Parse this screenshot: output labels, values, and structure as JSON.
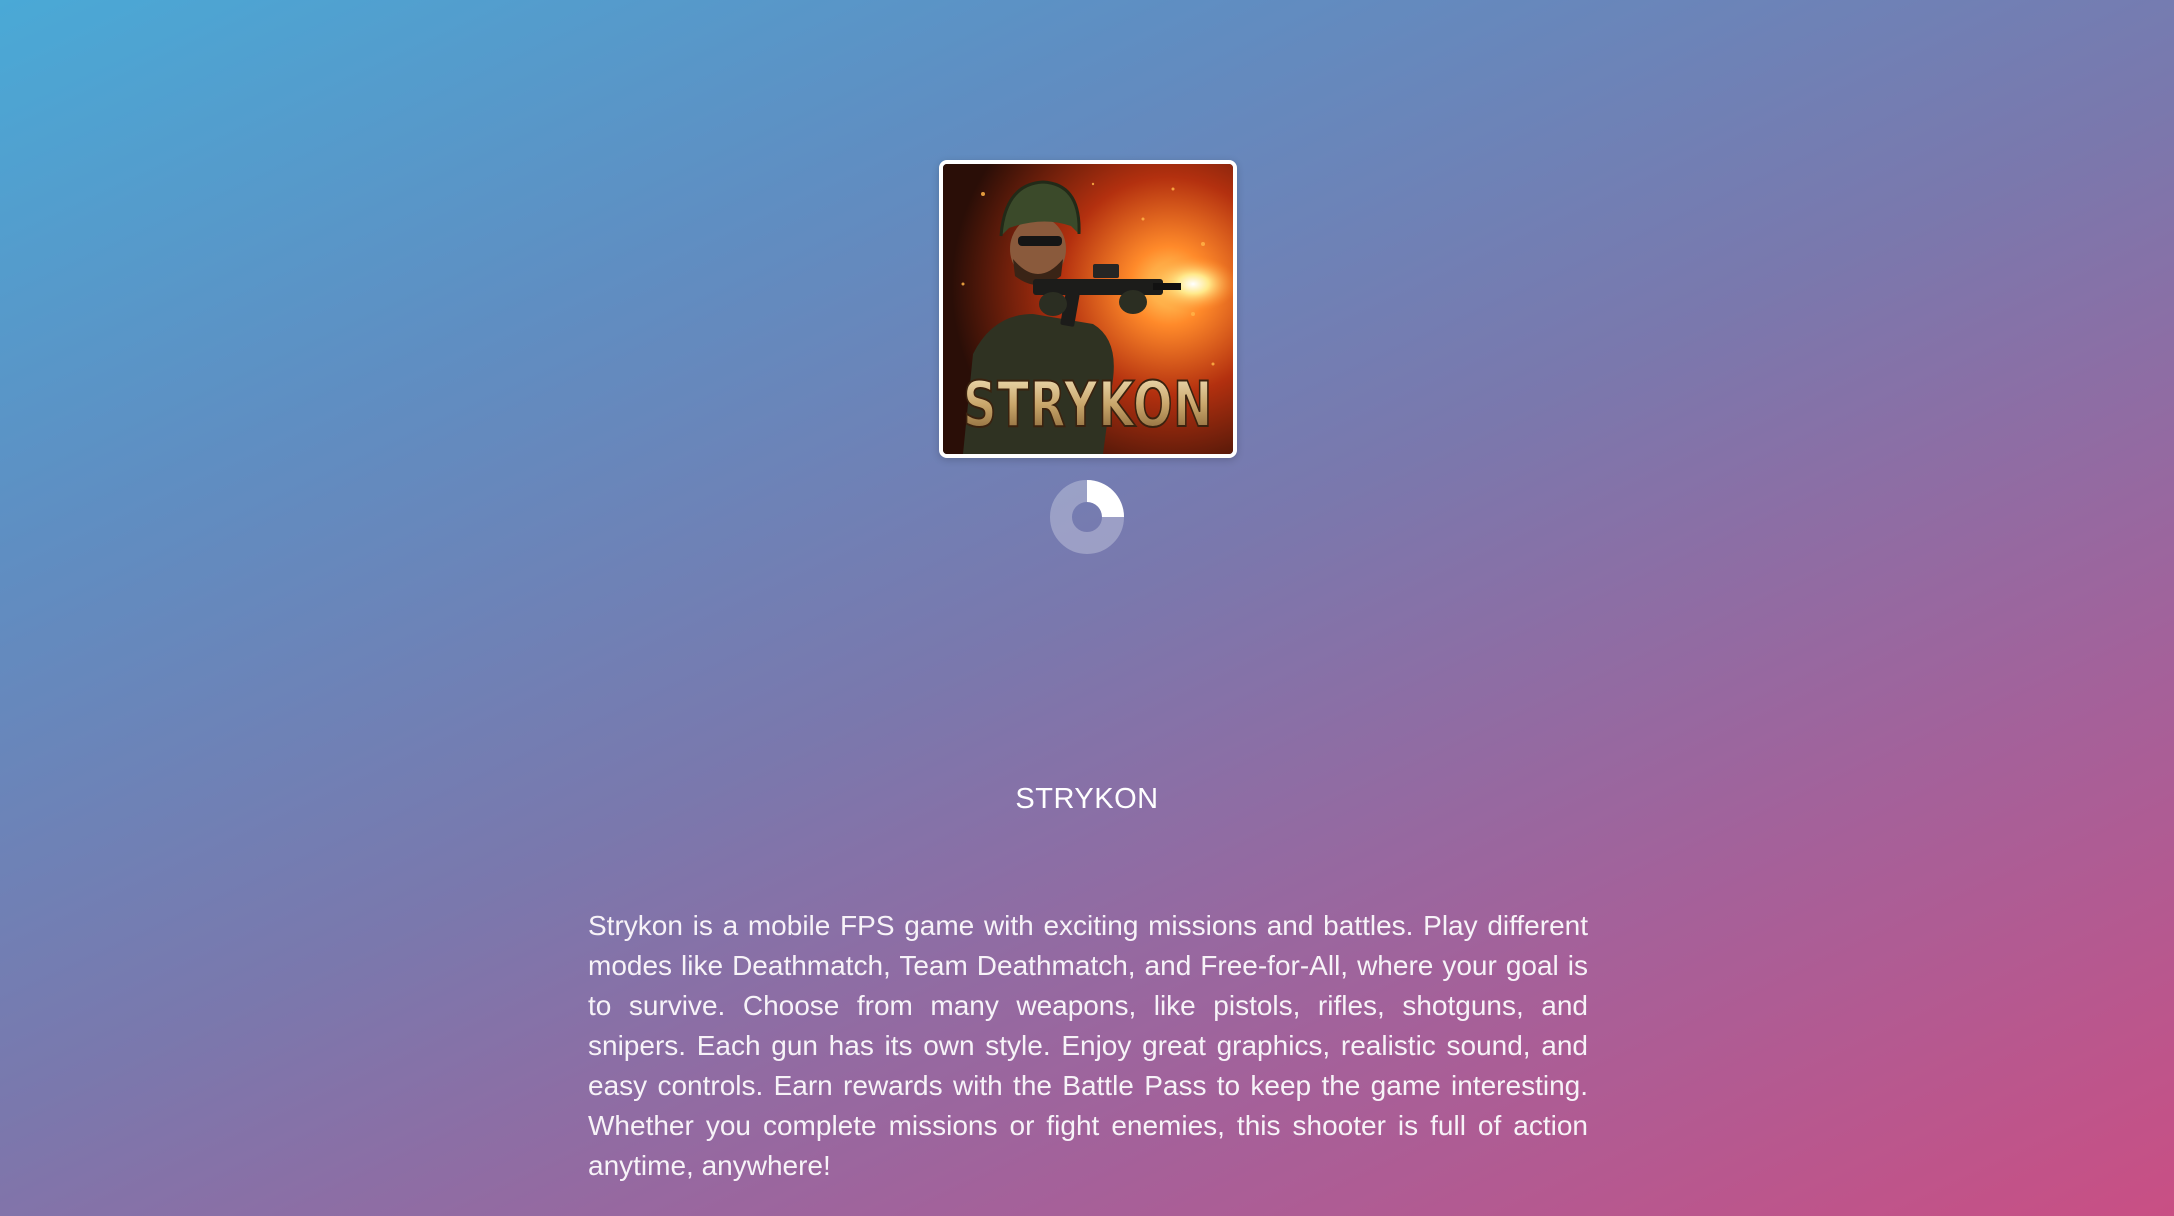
{
  "logo": {
    "icon": "strykon-game-cover-soldier",
    "wordmark": "STRYKON"
  },
  "loading": {
    "icon": "loading-spinner-icon",
    "progress": 0.25
  },
  "game": {
    "title": "STRYKON",
    "description": "Strykon is a mobile FPS game with exciting missions and battles. Play different modes like Deathmatch, Team Deathmatch, and Free-for-All, where your goal is to survive. Choose from many weapons, like pistols, rifles, shotguns, and snipers. Each gun has its own style. Enjoy great graphics, realistic sound, and easy controls. Earn rewards with the Battle Pass to keep the game interesting. Whether you complete missions or fight enemies, this shooter is full of action anytime, anywhere!"
  },
  "colors": {
    "gradient_start": "#4aa9d6",
    "gradient_mid": "#7a78ad",
    "gradient_end": "#c94f84",
    "text": "#ffffff"
  }
}
